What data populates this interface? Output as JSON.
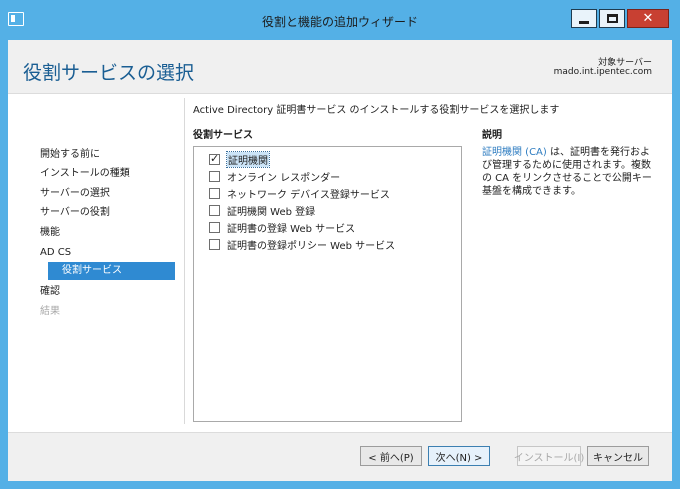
{
  "window": {
    "title": "役割と機能の追加ウィザード",
    "close_glyph": "✕",
    "icons": [
      "app-icon",
      "minimize-icon",
      "maximize-icon",
      "close-icon"
    ]
  },
  "header": {
    "title": "役割サービスの選択",
    "target_label": "対象サーバー",
    "target_server": "mado.int.ipentec.com"
  },
  "nav": {
    "items": [
      {
        "label": "開始する前に",
        "state": "normal"
      },
      {
        "label": "インストールの種類",
        "state": "normal"
      },
      {
        "label": "サーバーの選択",
        "state": "normal"
      },
      {
        "label": "サーバーの役割",
        "state": "normal"
      },
      {
        "label": "機能",
        "state": "normal"
      },
      {
        "label": "AD CS",
        "state": "normal"
      },
      {
        "label": "役割サービス",
        "state": "active"
      },
      {
        "label": "確認",
        "state": "normal"
      },
      {
        "label": "結果",
        "state": "disabled"
      }
    ]
  },
  "main": {
    "instruction": "Active Directory 証明書サービス のインストールする役割サービスを選択します",
    "roles_header": "役割サービス",
    "description_header": "説明",
    "roles": [
      {
        "label": "証明機関",
        "checked": true,
        "selected": true
      },
      {
        "label": "オンライン レスポンダー",
        "checked": false,
        "selected": false
      },
      {
        "label": "ネットワーク デバイス登録サービス",
        "checked": false,
        "selected": false
      },
      {
        "label": "証明機関 Web 登録",
        "checked": false,
        "selected": false
      },
      {
        "label": "証明書の登録 Web サービス",
        "checked": false,
        "selected": false
      },
      {
        "label": "証明書の登録ポリシー Web サービス",
        "checked": false,
        "selected": false
      }
    ],
    "description_link": "証明機関 (CA)",
    "description_text": " は、証明書を発行および管理するために使用されます。複数の CA をリンクさせることで公開キー基盤を構成できます。"
  },
  "footer": {
    "prev": "< 前へ(P)",
    "next": "次へ(N) >",
    "install": "インストール(I)",
    "cancel": "キャンセル"
  },
  "colors": {
    "frame": "#54b0e6",
    "title": "#1a5e93",
    "nav_active": "#2f8ad2",
    "link": "#2f7dc1",
    "close_button": "#c84032"
  }
}
